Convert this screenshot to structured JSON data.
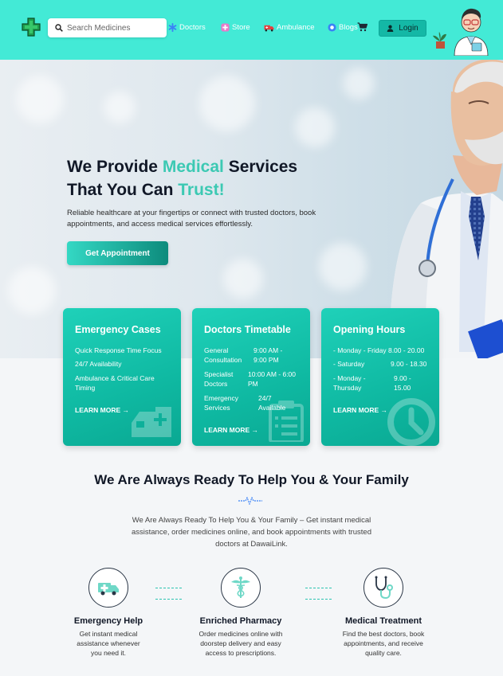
{
  "header": {
    "search_placeholder": "Search Medicines",
    "nav": [
      {
        "label": "Doctors",
        "icon": "asterisk-icon"
      },
      {
        "label": "Store",
        "icon": "plus-circle-icon"
      },
      {
        "label": "Ambulance",
        "icon": "ambulance-icon"
      },
      {
        "label": "Blogs",
        "icon": "globe-icon"
      }
    ],
    "login_label": "Login"
  },
  "hero": {
    "title_part1": "We Provide ",
    "title_accent1": "Medical",
    "title_part2": " Services",
    "title_line2": "That You Can ",
    "title_accent2": "Trust!",
    "description": "Reliable healthcare at your fingertips or connect with trusted doctors, book appointments, and access medical services effortlessly.",
    "cta_label": "Get Appointment"
  },
  "cards": [
    {
      "title": "Emergency Cases",
      "lines": [
        "Quick Response Time Focus",
        "24/7 Availability",
        "Ambulance & Critical Care",
        "Timing"
      ],
      "more": "LEARN MORE →",
      "icon": "ambulance-icon"
    },
    {
      "title": "Doctors Timetable",
      "rows": [
        {
          "label1": "General",
          "label2": "Consultation",
          "value1": "9:00 AM -",
          "value2": "9:00 PM"
        },
        {
          "label1": "Specialist",
          "label2": "Doctors",
          "value1": "10:00 AM - 6:00",
          "value2": "PM"
        },
        {
          "label1": "Emergency",
          "label2": "Services",
          "value1": "24/7",
          "value2": "Available"
        }
      ],
      "more": "LEARN MORE →",
      "icon": "clipboard-icon"
    },
    {
      "title": "Opening Hours",
      "rows": [
        {
          "label1": "- Monday - Friday 8.00 - 20.00",
          "label2": "",
          "value1": "",
          "value2": ""
        },
        {
          "label1": "- Saturday",
          "label2": "",
          "value1": "9.00 - 18.30",
          "value2": ""
        },
        {
          "label1": "- Monday -",
          "label2": "Thursday",
          "value1": "9.00 -",
          "value2": "15.00"
        }
      ],
      "more": "LEARN MORE →",
      "icon": "clock-icon"
    }
  ],
  "section": {
    "title": "We Are Always Ready To Help You & Your Family",
    "description": "We Are Always Ready To Help You & Your Family – Get instant medical assistance, order medicines online, and book appointments with trusted doctors at DawaiLink."
  },
  "features": [
    {
      "title": "Emergency Help",
      "desc": [
        "Get instant medical",
        "assistance whenever",
        "you need it."
      ],
      "icon": "ambulance-icon"
    },
    {
      "title": "Enriched Pharmacy",
      "desc": [
        "Order medicines online with",
        "doorstep delivery and easy",
        "access to prescriptions."
      ],
      "icon": "caduceus-icon"
    },
    {
      "title": "Medical Treatment",
      "desc": [
        "Find the best doctors, book",
        "appointments, and receive",
        "quality care."
      ],
      "icon": "stethoscope-icon"
    }
  ],
  "colors": {
    "header_bg": "#43ead6",
    "accent": "#3cc9b3",
    "card": "#14c4ad",
    "button": "#0d8b7c"
  }
}
